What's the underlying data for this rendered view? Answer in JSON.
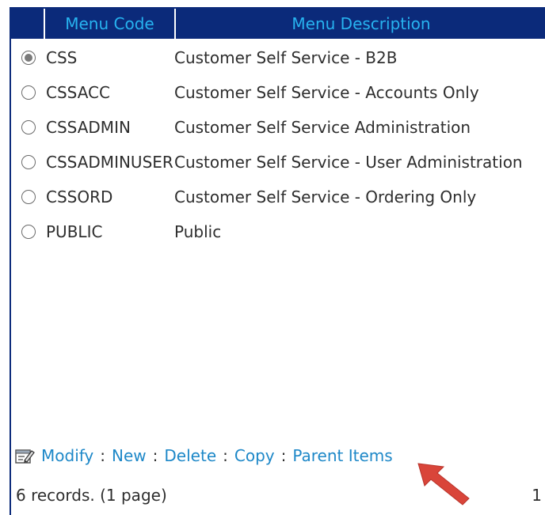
{
  "table": {
    "columns": [
      "Menu Code",
      "Menu Description"
    ],
    "rows": [
      {
        "code": "CSS",
        "description": "Customer Self Service - B2B",
        "selected": true
      },
      {
        "code": "CSSACC",
        "description": "Customer Self Service - Accounts Only",
        "selected": false
      },
      {
        "code": "CSSADMIN",
        "description": "Customer Self Service Administration",
        "selected": false
      },
      {
        "code": "CSSADMINUSER",
        "description": "Customer Self Service - User Administration",
        "selected": false
      },
      {
        "code": "CSSORD",
        "description": "Customer Self Service - Ordering Only",
        "selected": false
      },
      {
        "code": "PUBLIC",
        "description": "Public",
        "selected": false
      }
    ]
  },
  "actions": {
    "icon": "edit-form-icon",
    "modify": "Modify",
    "new": "New",
    "delete": "Delete",
    "copy": "Copy",
    "parent_items": "Parent Items",
    "separator": ":"
  },
  "footer": {
    "records": "6 records. (1 page)",
    "page": "1"
  },
  "annotation": {
    "icon": "red-arrow-icon",
    "color": "#d9453a"
  },
  "colors": {
    "header_bg": "#0b2a7a",
    "header_text": "#27b3f0",
    "link": "#1e88c8"
  }
}
